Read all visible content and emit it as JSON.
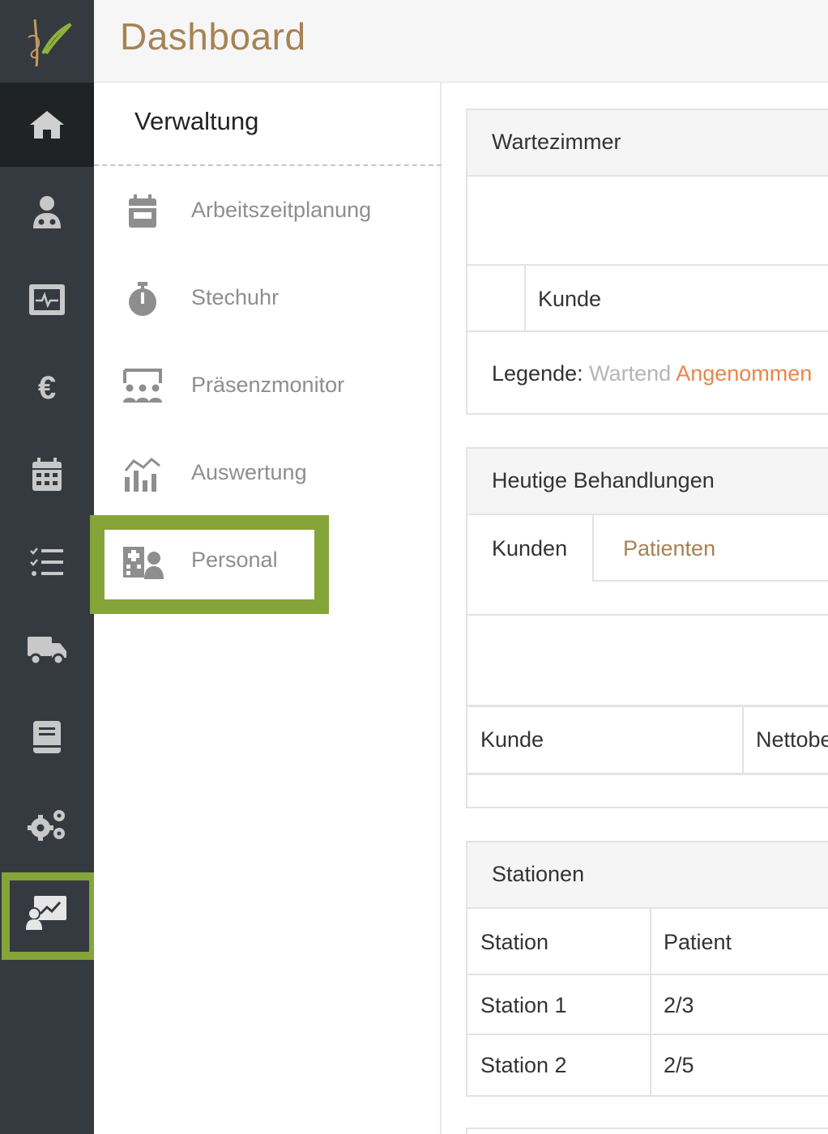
{
  "header": {
    "title": "Dashboard"
  },
  "rail": {
    "items": [
      {
        "name": "home-icon"
      },
      {
        "name": "doctor-icon"
      },
      {
        "name": "monitor-waveform-icon"
      },
      {
        "name": "euro-icon"
      },
      {
        "name": "calendar-icon"
      },
      {
        "name": "checklist-icon"
      },
      {
        "name": "truck-icon"
      },
      {
        "name": "book-icon"
      },
      {
        "name": "settings-gears-icon"
      },
      {
        "name": "presentation-chart-icon"
      }
    ]
  },
  "submenu": {
    "title": "Verwaltung",
    "items": [
      {
        "label": "Arbeitszeitplanung",
        "icon": "calendar-icon"
      },
      {
        "label": "Stechuhr",
        "icon": "stopwatch-icon"
      },
      {
        "label": "Präsenzmonitor",
        "icon": "group-presence-icon"
      },
      {
        "label": "Auswertung",
        "icon": "analytics-chart-icon"
      },
      {
        "label": "Personal",
        "icon": "hospital-staff-icon"
      }
    ]
  },
  "waiting_room": {
    "title": "Wartezimmer",
    "column_kunde": "Kunde",
    "legend_label": "Legende:",
    "legend_waiting": "Wartend",
    "legend_accepted": "Angenommen"
  },
  "treatments": {
    "title": "Heutige Behandlungen",
    "tab_customers": "Kunden",
    "tab_patients": "Patienten",
    "col_customer": "Kunde",
    "col_net": "Nettobe"
  },
  "stations": {
    "title": "Stationen",
    "headers": [
      "Station",
      "Patient"
    ],
    "rows": [
      [
        "Station 1",
        "2/3"
      ],
      [
        "Station 2",
        "2/5"
      ]
    ]
  },
  "colors": {
    "accent_brown": "#a78253",
    "highlight_green": "#85a53a",
    "legend_accepted": "#e8864a",
    "rail_bg": "#343a40"
  }
}
